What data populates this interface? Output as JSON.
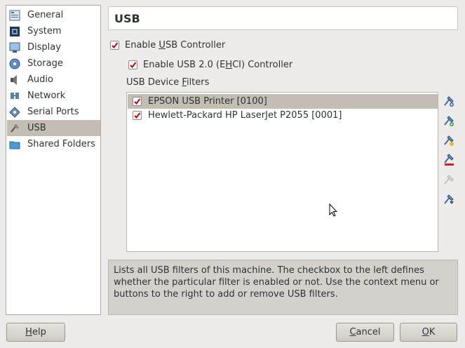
{
  "sidebar": {
    "items": [
      {
        "label": "General",
        "icon": "general-icon"
      },
      {
        "label": "System",
        "icon": "system-icon"
      },
      {
        "label": "Display",
        "icon": "display-icon"
      },
      {
        "label": "Storage",
        "icon": "storage-icon"
      },
      {
        "label": "Audio",
        "icon": "audio-icon"
      },
      {
        "label": "Network",
        "icon": "network-icon"
      },
      {
        "label": "Serial Ports",
        "icon": "serial-ports-icon"
      },
      {
        "label": "USB",
        "icon": "usb-icon",
        "selected": true
      },
      {
        "label": "Shared Folders",
        "icon": "shared-folders-icon"
      }
    ]
  },
  "page": {
    "title": "USB",
    "enable_usb": {
      "pre": "Enable ",
      "mnemonic": "U",
      "post": "SB Controller",
      "checked": true
    },
    "enable_usb2": {
      "pre": "Enable USB 2.0 (E",
      "mnemonic": "H",
      "post": "CI) Controller",
      "checked": true
    },
    "filters_label": {
      "pre": "USB Device ",
      "mnemonic": "F",
      "post": "ilters"
    },
    "filters": [
      {
        "name": "EPSON USB Printer [0100]",
        "checked": true,
        "selected": true
      },
      {
        "name": "Hewlett-Packard HP LaserJet P2055 [0001]",
        "checked": true,
        "selected": false
      }
    ],
    "tools": [
      {
        "icon": "add-empty-filter-icon"
      },
      {
        "icon": "add-filter-from-device-icon"
      },
      {
        "icon": "edit-filter-icon"
      },
      {
        "icon": "remove-filter-icon"
      },
      {
        "icon": "move-filter-up-icon",
        "disabled": true
      },
      {
        "icon": "move-filter-down-icon"
      }
    ],
    "description": "Lists all USB filters of this machine. The checkbox to the left defines whether the particular filter is enabled or not. Use the context menu or buttons to the right to add or remove USB filters."
  },
  "buttons": {
    "help": {
      "mnemonic": "H",
      "post": "elp"
    },
    "cancel": {
      "mnemonic": "C",
      "post": "ancel"
    },
    "ok": {
      "mnemonic": "O",
      "post": "K"
    }
  },
  "colors": {
    "selection": "#c3bdb3",
    "check": "#cc0000",
    "window": "#edeceb"
  }
}
